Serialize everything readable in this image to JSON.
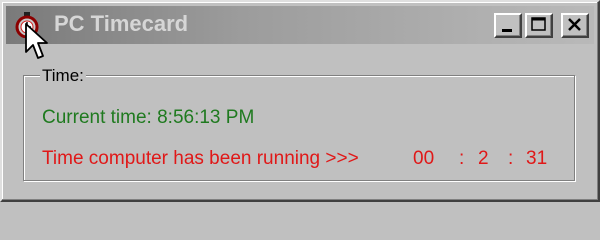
{
  "window": {
    "title": "PC Timecard",
    "buttons": {
      "minimize": "minimize",
      "maximize": "maximize",
      "close": "close"
    }
  },
  "group": {
    "label": "Time:"
  },
  "current_time": {
    "label": "Current time:",
    "value": "8:56:13 PM"
  },
  "running": {
    "label": "Time computer has been running >>>",
    "hours": "00",
    "minutes": "2",
    "seconds": "31",
    "separator": ":"
  },
  "colors": {
    "current_time_text": "#1f7a1f",
    "running_text": "#e01818",
    "face": "#c0c0c0"
  },
  "icons": {
    "app": "stopwatch-icon",
    "cursor": "mouse-pointer-icon"
  }
}
